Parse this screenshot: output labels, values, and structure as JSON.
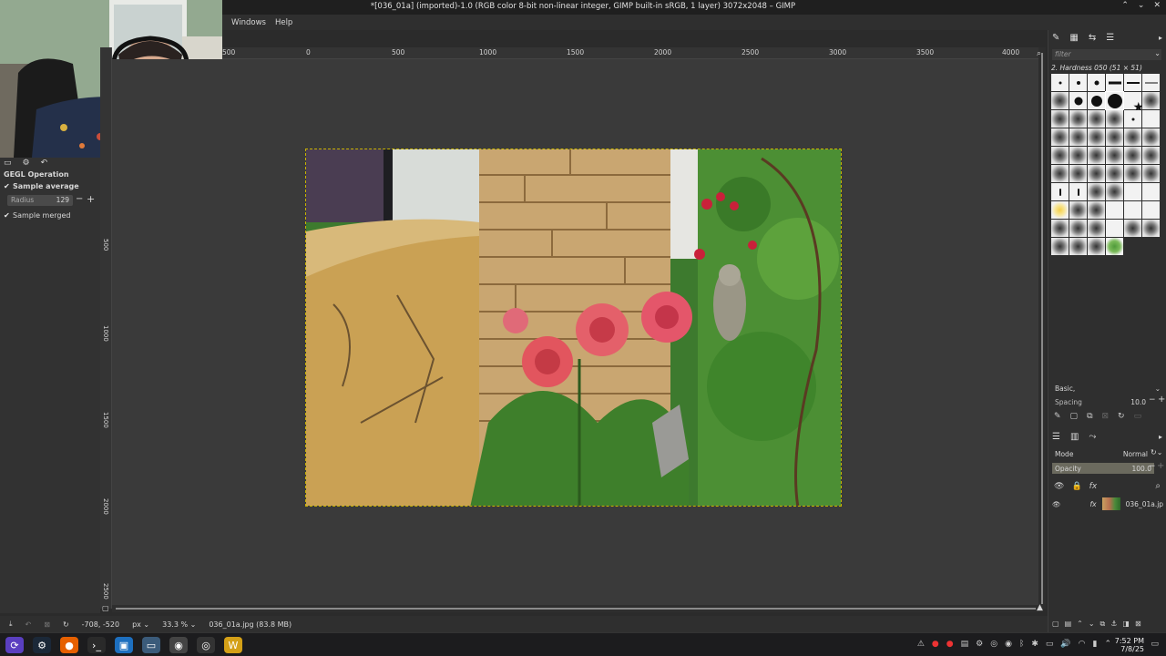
{
  "window": {
    "title": "*[036_01a] (imported)-1.0 (RGB color 8-bit non-linear integer, GIMP built-in sRGB, 1 layer) 3072x2048 – GIMP",
    "controls": [
      "⌃",
      "⌄",
      "✕"
    ]
  },
  "menu": {
    "items": [
      "Windows",
      "Help"
    ]
  },
  "tool_options": {
    "heading": "GEGL Operation",
    "sample_average": "Sample average",
    "radius_label": "Radius",
    "radius_value": "129",
    "sample_merged": "Sample merged"
  },
  "ruler": {
    "h_ticks": [
      "500",
      "0",
      "500",
      "1000",
      "1500",
      "2000",
      "2500",
      "3000",
      "3500",
      "4000"
    ],
    "v_ticks": [
      "500",
      "1000",
      "1500",
      "2000",
      "2500"
    ]
  },
  "status": {
    "coords": "-708, -520",
    "unit": "px",
    "zoom": "33.3 %",
    "file_info": "036_01a.jpg (83.8 MB)"
  },
  "brushes": {
    "filter_placeholder": "filter",
    "current": "2. Hardness 050 (51 × 51)",
    "preset": "Basic,",
    "spacing_label": "Spacing",
    "spacing_value": "10.0"
  },
  "layers": {
    "mode_label": "Mode",
    "mode_value": "Normal",
    "opacity_label": "Opacity",
    "opacity_value": "100.0",
    "layer_name": "036_01a.jp"
  },
  "clock": {
    "time": "7:52 PM",
    "date": "7/8/25"
  }
}
